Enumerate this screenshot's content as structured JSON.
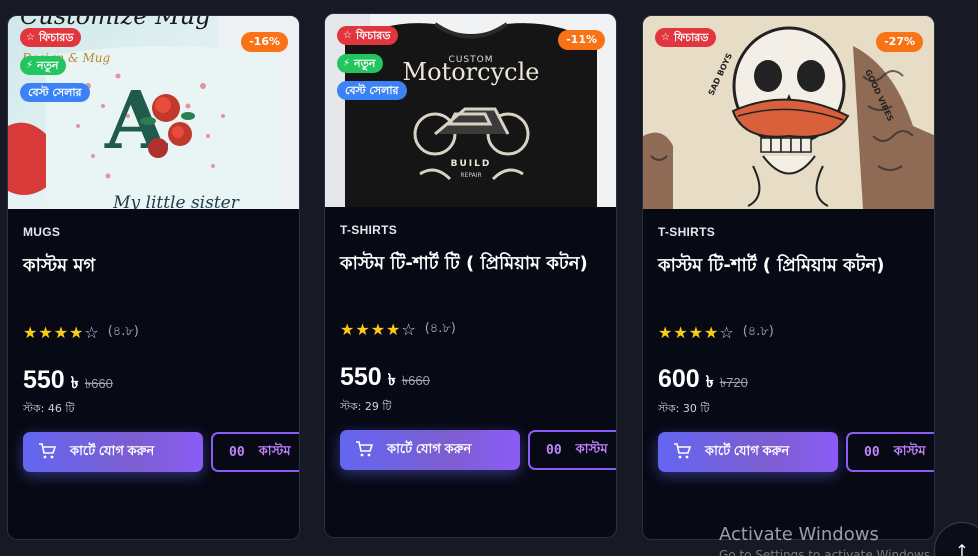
{
  "badges": {
    "featured": "ফিচারড",
    "new": "নতুন",
    "best_seller": "বেস্ট সেলার"
  },
  "buttons": {
    "add_to_cart": "কার্টে যোগ করুন",
    "customize": "কাস্টম"
  },
  "products": [
    {
      "discount": "-16%",
      "category": "MUGS",
      "title": "কাস্টম মগ",
      "rating_text": "(৪.৮)",
      "stars": 4,
      "price": "550",
      "currency": "৳",
      "old_price": "৳660",
      "stock": "স্টক: 46 টি",
      "image_text": {
        "headline": "Customize Mug",
        "sub": "Design & Mug",
        "letter": "A",
        "caption": "My little sister"
      }
    },
    {
      "discount": "-11%",
      "category": "T-SHIRTS",
      "title": "কাস্টম টি-শার্ট টি ( প্রিমিয়াম কটন)",
      "rating_text": "(৪.৮)",
      "stars": 4,
      "price": "550",
      "currency": "৳",
      "old_price": "৳660",
      "stock": "স্টক: 29 টি",
      "image_text": {
        "top": "CUSTOM",
        "headline": "Motorcycle",
        "bottom": "BUILD",
        "small": "REPAIR"
      }
    },
    {
      "discount": "-27%",
      "category": "T-SHIRTS",
      "title": "কাস্টম টি-শার্ট ( প্রিমিয়াম কটন)",
      "rating_text": "(৪.৮)",
      "stars": 4,
      "price": "600",
      "currency": "৳",
      "old_price": "৳720",
      "stock": "স্টক: 30 টি",
      "image_text": {
        "left": "SAD BOYS",
        "right": "GOOD VIBES"
      }
    }
  ],
  "watermark": {
    "title": "Activate Windows",
    "sub": "Go to Settings to activate Windows."
  },
  "icons": {
    "cart": "cart-icon",
    "customize": "customize-icon",
    "star": "star-icon",
    "arrow_up": "arrow-up-icon"
  },
  "colors": {
    "page_bg": "#171a25",
    "card_bg": "#070914",
    "featured": "#e2363f",
    "new": "#22c55e",
    "best_seller": "#3b82f6",
    "discount": "#f97316",
    "star": "#facc15",
    "accent": "#8b5cf6"
  }
}
